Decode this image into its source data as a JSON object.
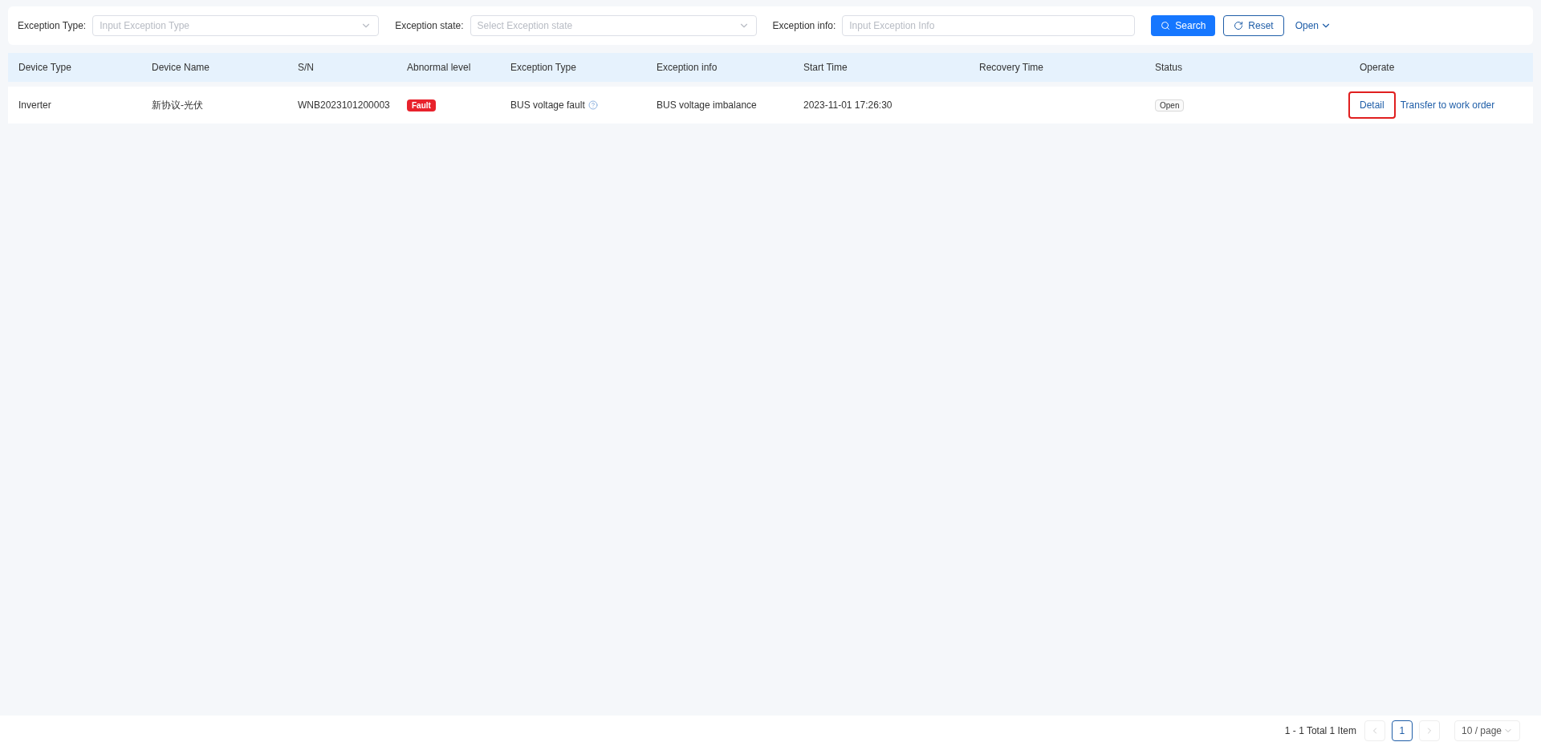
{
  "filters": [
    {
      "label": "Exception Type:",
      "placeholder": "Input Exception Type",
      "kind": "select"
    },
    {
      "label": "Exception state:",
      "placeholder": "Select Exception state",
      "kind": "select"
    },
    {
      "label": "Exception info:",
      "placeholder": "Input Exception Info",
      "kind": "input"
    }
  ],
  "buttons": {
    "search": "Search",
    "reset": "Reset",
    "expand": "Open"
  },
  "table": {
    "columns": [
      "Device Type",
      "Device Name",
      "S/N",
      "Abnormal level",
      "Exception Type",
      "Exception info",
      "Start Time",
      "Recovery Time",
      "Status",
      "Operate"
    ],
    "rows": [
      {
        "device_type": "Inverter",
        "device_name": "新协议-光伏",
        "sn": "WNB2023101200003",
        "abnormal_level": "Fault",
        "exception_type": "BUS voltage fault",
        "exception_info": "BUS voltage imbalance",
        "start_time": "2023-11-01 17:26:30",
        "status": "Open",
        "actions": [
          {
            "label": "Detail",
            "highlighted": true
          },
          {
            "label": "Transfer to work order",
            "highlighted": false
          }
        ]
      }
    ]
  },
  "pagination": {
    "summary": "1 - 1 Total 1 Item",
    "pages": [
      {
        "label": "1",
        "selected": true
      }
    ],
    "page_size": "10 / page"
  }
}
